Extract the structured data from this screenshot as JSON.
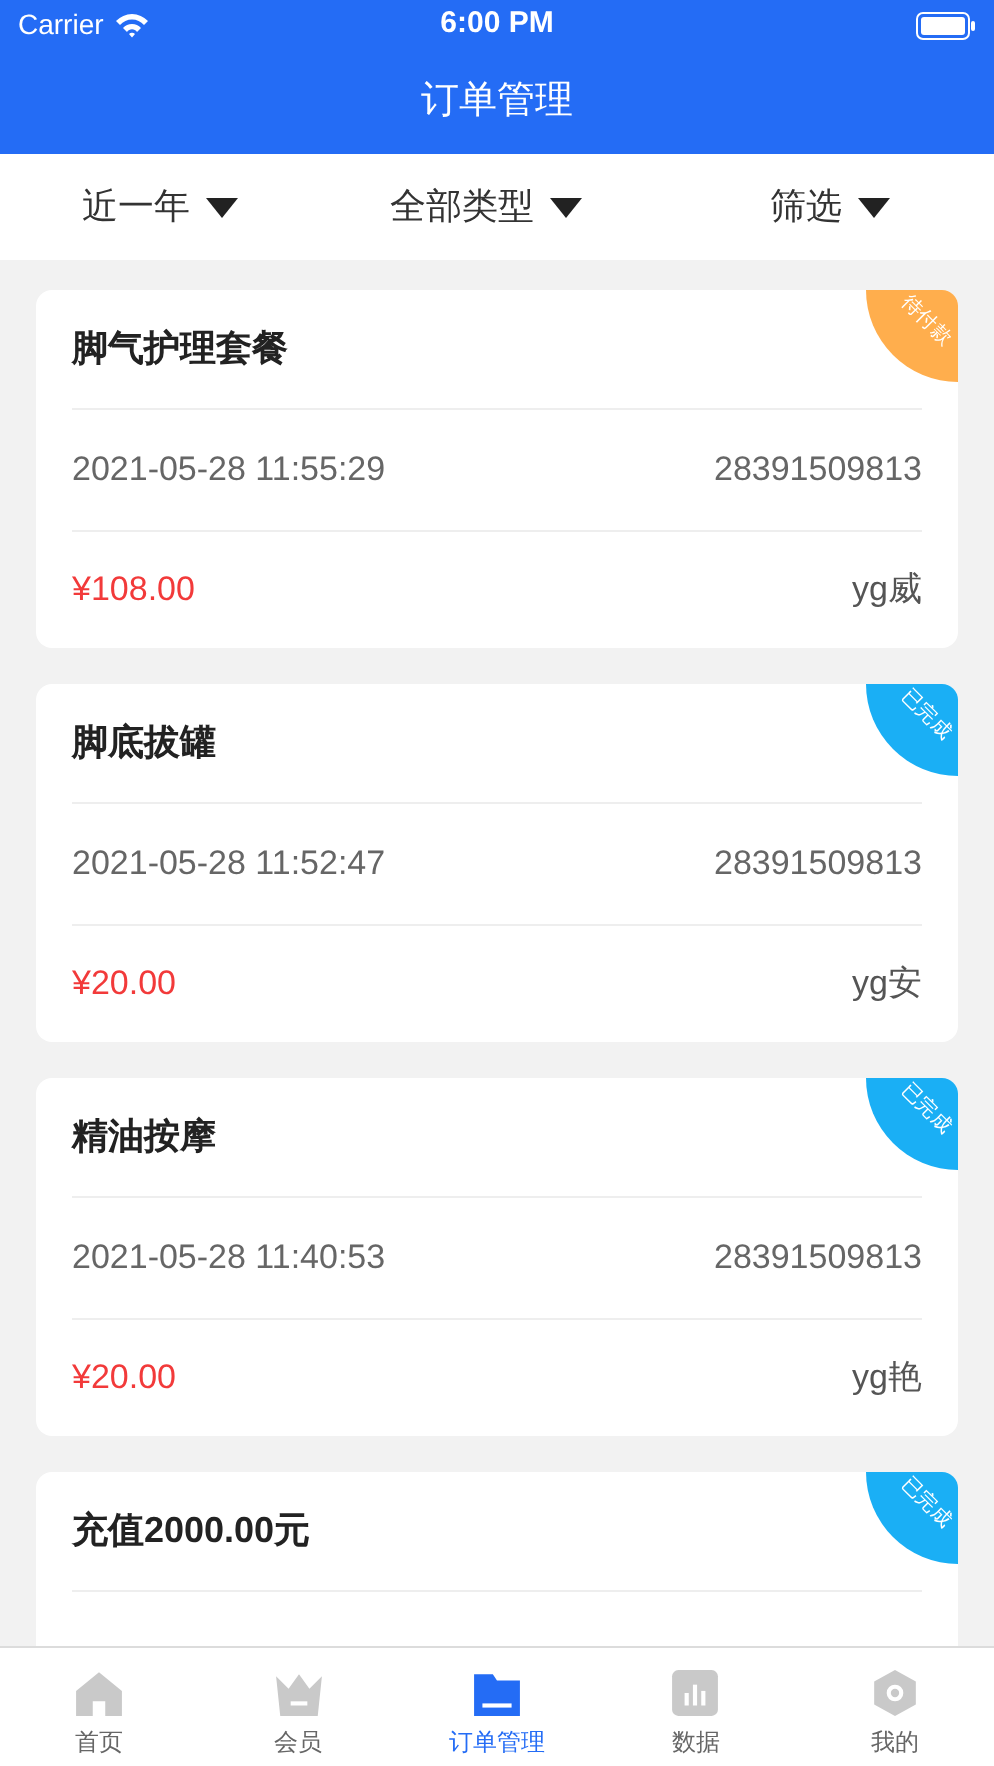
{
  "status_bar": {
    "carrier": "Carrier",
    "time": "6:00 PM"
  },
  "nav": {
    "title": "订单管理"
  },
  "filters": [
    {
      "label": "近一年"
    },
    {
      "label": "全部类型"
    },
    {
      "label": "筛选"
    }
  ],
  "orders": [
    {
      "title": "脚气护理套餐",
      "status": {
        "kind": "pending",
        "label": "待付款"
      },
      "date": "2021-05-28 11:55:29",
      "number": "28391509813",
      "price": "¥108.00",
      "staff": "yg威"
    },
    {
      "title": "脚底拔罐",
      "status": {
        "kind": "done",
        "label": "已完成"
      },
      "date": "2021-05-28 11:52:47",
      "number": "28391509813",
      "price": "¥20.00",
      "staff": "yg安"
    },
    {
      "title": "精油按摩",
      "status": {
        "kind": "done",
        "label": "已完成"
      },
      "date": "2021-05-28 11:40:53",
      "number": "28391509813",
      "price": "¥20.00",
      "staff": "yg艳"
    },
    {
      "title": "充值2000.00元",
      "status": {
        "kind": "done",
        "label": "已完成"
      }
    }
  ],
  "tab_bar": [
    {
      "label": "首页",
      "selected": false
    },
    {
      "label": "会员",
      "selected": false
    },
    {
      "label": "订单管理",
      "selected": true
    },
    {
      "label": "数据",
      "selected": false
    },
    {
      "label": "我的",
      "selected": false
    }
  ]
}
